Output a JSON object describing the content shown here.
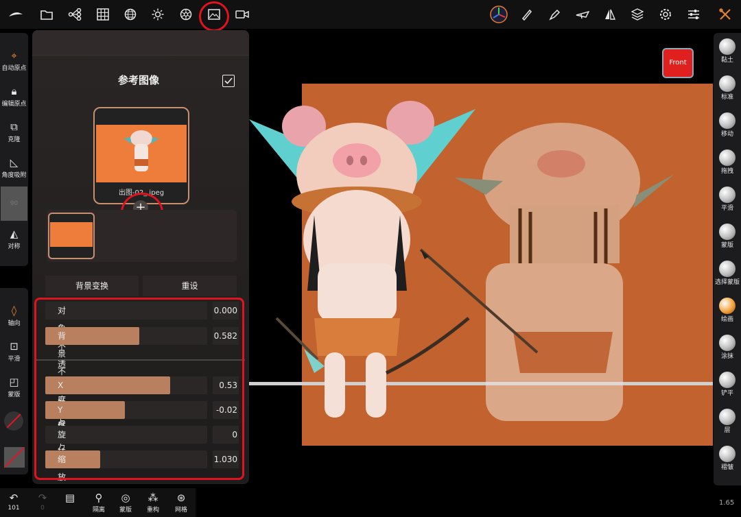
{
  "topbar": {
    "icons": [
      "logo-icon",
      "folder-icon",
      "scene-tree-icon",
      "grid-icon",
      "sphere-icon",
      "light-icon",
      "material-icon",
      "reference-image-icon",
      "camera-icon"
    ],
    "right_icons": [
      "gizmo-icon",
      "brush-pen-icon",
      "pen-icon",
      "airplane-icon",
      "symmetry-icon",
      "layers-icon",
      "settings-icon",
      "sliders-icon",
      "tools-icon"
    ]
  },
  "left_toolbar": {
    "items": [
      {
        "label": "自动原点",
        "icon": "crosshair-icon"
      },
      {
        "label": "编辑原点",
        "icon": "lock-icon"
      },
      {
        "label": "克隆",
        "icon": "clone-icon"
      },
      {
        "label": "角度吸附",
        "icon": "angle-icon"
      },
      {
        "label": "90",
        "icon": "value"
      },
      {
        "label": "对称",
        "icon": "symmetry-icon"
      }
    ],
    "items2": [
      {
        "label": "轴向",
        "icon": "axis-icon"
      },
      {
        "label": "平滑",
        "icon": "smooth-icon"
      },
      {
        "label": "蒙版",
        "icon": "mask-icon"
      }
    ]
  },
  "panel": {
    "title": "参考图像",
    "image_name": "出图-02_.jpeg",
    "transform_button": "背景变换",
    "reset_button": "重设",
    "sliders": [
      {
        "label": "对象不透明度",
        "value": "0.000",
        "fill": 0
      },
      {
        "label": "背景不透明度",
        "value": "0.582",
        "fill": 0.582
      },
      {
        "label": "X轴方向",
        "value": "0.53",
        "fill": 0.77
      },
      {
        "label": "Y轴方向",
        "value": "-0.02",
        "fill": 0.49
      },
      {
        "label": "旋转",
        "value": "0",
        "fill": 0
      },
      {
        "label": "缩放",
        "value": "1.030",
        "fill": 0.34
      }
    ]
  },
  "front_button": "Front",
  "right_toolbar": {
    "items": [
      "黏土",
      "标准",
      "移动",
      "拖拽",
      "平滑",
      "蒙版",
      "选择蒙版",
      "绘画",
      "涂抹",
      "铲平",
      "层",
      "褶皱"
    ]
  },
  "bottombar": {
    "items": [
      {
        "label": "101",
        "icon": "undo-icon"
      },
      {
        "label": "0",
        "icon": "redo-icon"
      },
      {
        "label": "",
        "icon": "document-icon"
      },
      {
        "label": "隔离",
        "icon": "isolate-icon"
      },
      {
        "label": "蒙版",
        "icon": "mask-visibility-icon"
      },
      {
        "label": "重构",
        "icon": "remesh-icon"
      },
      {
        "label": "网格",
        "icon": "mesh-icon"
      }
    ]
  },
  "status_value": "1.65",
  "colors": {
    "accent": "#b9805f",
    "background_image": "#c1622f",
    "highlight": "#e0141e"
  }
}
